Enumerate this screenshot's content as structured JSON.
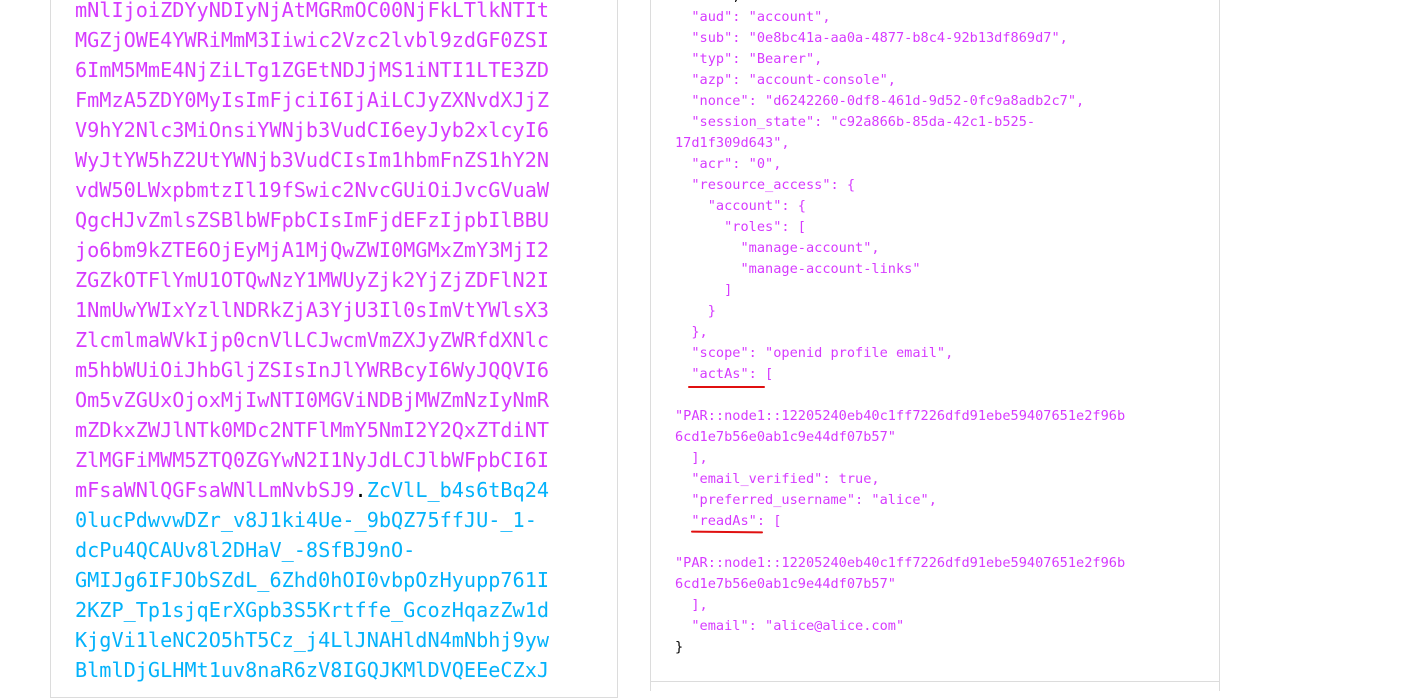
{
  "token": {
    "payload_lines": [
      "mNlIjoiZDYyNDIyNjAtMGRmOC00NjFkLTlkNTIt",
      "MGZjOWE4YWRiMmM3Iiwic2Vzc2lvbl9zdGF0ZSI",
      "6ImM5MmE4NjZiLTg1ZGEtNDJjMS1iNTI1LTE3ZD",
      "FmMzA5ZDY0MyIsImFjciI6IjAiLCJyZXNvdXJjZ",
      "V9hY2Nlc3MiOnsiYWNjb3VudCI6eyJyb2xlcyI6",
      "WyJtYW5hZ2UtYWNjb3VudCIsIm1hbmFnZS1hY2N",
      "vdW50LWxpbmtzIl19fSwic2NvcGUiOiJvcGVuaW",
      "QgcHJvZmlsZSBlbWFpbCIsImFjdEFzIjpbIlBBU",
      "jo6bm9kZTE6OjEyMjA1MjQwZWI0MGMxZmY3MjI2",
      "ZGZkOTFlYmU1OTQwNzY1MWUyZjk2YjZjZDFlN2I",
      "1NmUwYWIxYzllNDRkZjA3YjU3Il0sImVtYWlsX3",
      "ZlcmlmaWVkIjp0cnVlLCJwcmVmZXJyZWRfdXNlc",
      "m5hbWUiOiJhbGljZSIsInJlYWRBcyI6WyJQQVI6",
      "Om5vZGUxOjoxMjIwNTI0MGViNDBjMWZmNzIyNmR",
      "mZDkxZWJlNTk0MDc2NTFlMmY5NmI2Y2QxZTdiNT",
      "ZlMGFiMWM5ZTQ0ZGYwN2I1NyJdLCJlbWFpbCI6I",
      "mFsaWNlQGFsaWNlLmNvbSJ9"
    ],
    "separator": ".",
    "signature_first": "ZcVlL_b4s6tBq24",
    "signature_lines": [
      "0lucPdwvwDZr_v8J1ki4Ue-_9bQZ75ffJU-_1-",
      "dcPu4QCAUv8l2DHaV_-8SfBJ9nO-",
      "GMIJg6IFJObSZdL_6Zhd0hOI0vbpOzHyupp761I",
      "2KZP_Tp1sjqErXGpb3S5Krtffe_GcozHqazZw1d",
      "KjgVi1leNC2O5hT5Cz_j4LlJNAHldN4mNbhj9yw",
      "BlmlDjGLHMt1uv8naR6zV8IGQJKMlDVQEEeCZxJ"
    ]
  },
  "claims_text": {
    "l00": "  \"aud\": \"account\",",
    "l01": "  \"sub\": \"0e8bc41a-aa0a-4877-b8c4-92b13df869d7\",",
    "l02": "  \"typ\": \"Bearer\",",
    "l03": "  \"azp\": \"account-console\",",
    "l04": "  \"nonce\": \"d6242260-0df8-461d-9d52-0fc9a8adb2c7\",",
    "l05": "  \"session_state\": \"c92a866b-85da-42c1-b525-",
    "l06": "17d1f309d643\",",
    "l07": "  \"acr\": \"0\",",
    "l08": "  \"resource_access\": {",
    "l09": "    \"account\": {",
    "l10": "      \"roles\": [",
    "l11": "        \"manage-account\",",
    "l12": "        \"manage-account-links\"",
    "l13": "      ]",
    "l14": "    }",
    "l15": "  },",
    "l16": "  \"scope\": \"openid profile email\",",
    "l17": "  \"actAs\": [",
    "l18": "",
    "l19": "\"PAR::node1::12205240eb40c1ff7226dfd91ebe59407651e2f96b",
    "l20": "6cd1e7b56e0ab1c9e44df07b57\"",
    "l21": "  ],",
    "l22": "  \"email_verified\": true,",
    "l23": "  \"preferred_username\": \"alice\",",
    "l24": "  \"readAs\": [",
    "l25": "",
    "l26": "\"PAR::node1::12205240eb40c1ff7226dfd91ebe59407651e2f96b",
    "l27": "6cd1e7b56e0ab1c9e44df07b57\"",
    "l28": "  ],",
    "l29": "  \"email\": \"alice@alice.com\"",
    "l30": "}"
  },
  "colors": {
    "payload": "#d63aff",
    "signature": "#03b2fb",
    "highlight": "#e01010"
  }
}
